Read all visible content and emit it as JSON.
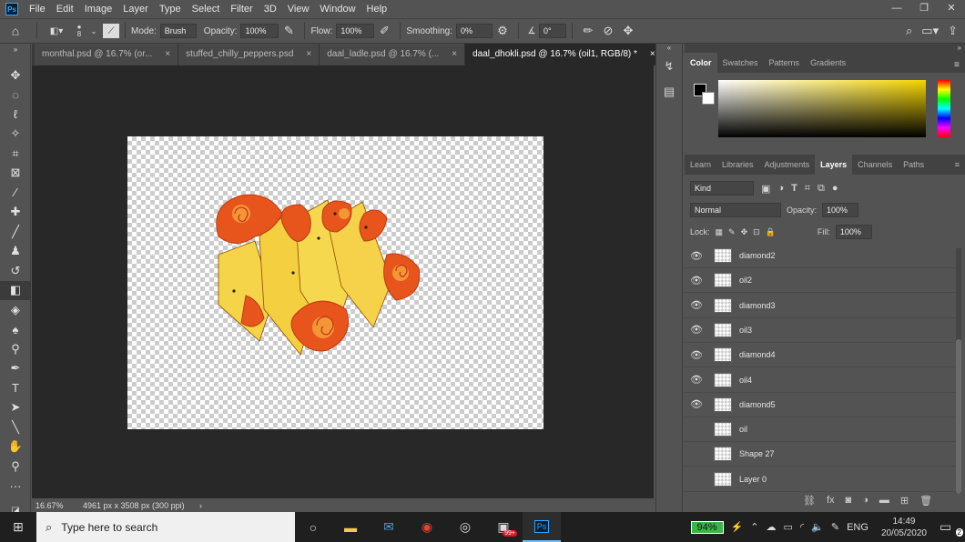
{
  "app": {
    "logo": "Ps"
  },
  "menu": [
    "File",
    "Edit",
    "Image",
    "Layer",
    "Type",
    "Select",
    "Filter",
    "3D",
    "View",
    "Window",
    "Help"
  ],
  "window_controls": [
    "—",
    "❐",
    "✕"
  ],
  "options": {
    "brush_size": "8",
    "mode_label": "Mode:",
    "mode_value": "Brush",
    "opacity_label": "Opacity:",
    "opacity_value": "100%",
    "flow_label": "Flow:",
    "flow_value": "100%",
    "smoothing_label": "Smoothing:",
    "smoothing_value": "0%",
    "angle_value": "0°"
  },
  "tabs": [
    {
      "label": "monthal.psd @ 16.7% (or...",
      "close": "×"
    },
    {
      "label": "stuffed_chilly_peppers.psd",
      "close": "×"
    },
    {
      "label": "daal_ladle.psd @ 16.7% (...",
      "close": "×"
    },
    {
      "label": "daal_dhokli.psd @ 16.7% (oil1, RGB/8) *",
      "close": "×"
    }
  ],
  "status": {
    "zoom": "16.67%",
    "doc_info": "4961 px x 3508 px (300 ppi)",
    "arrow": "›"
  },
  "color_panel": {
    "tabs": [
      "Color",
      "Swatches",
      "Patterns",
      "Gradients"
    ]
  },
  "layers_panel": {
    "tabs": [
      "Learn",
      "Libraries",
      "Adjustments",
      "Layers",
      "Channels",
      "Paths"
    ],
    "filter_kind": "Kind",
    "blend_mode": "Normal",
    "opacity_label": "Opacity:",
    "opacity_value": "100%",
    "lock_label": "Lock:",
    "fill_label": "Fill:",
    "fill_value": "100%",
    "layers": [
      {
        "name": "diamond2",
        "visible": true
      },
      {
        "name": "oil2",
        "visible": true
      },
      {
        "name": "diamond3",
        "visible": true
      },
      {
        "name": "oil3",
        "visible": true
      },
      {
        "name": "diamond4",
        "visible": true
      },
      {
        "name": "oil4",
        "visible": true
      },
      {
        "name": "diamond5",
        "visible": true
      },
      {
        "name": "oil",
        "visible": false
      },
      {
        "name": "Shape 27",
        "visible": false
      },
      {
        "name": "Layer 0",
        "visible": false
      }
    ]
  },
  "taskbar": {
    "search_placeholder": "Type here to search",
    "battery": "94%",
    "language": "ENG",
    "time": "14:49",
    "date": "20/05/2020",
    "notifications": "2",
    "mail_badge": "99+"
  },
  "colors": {
    "accent": "#31a8ff",
    "battery": "#3bb54a"
  }
}
